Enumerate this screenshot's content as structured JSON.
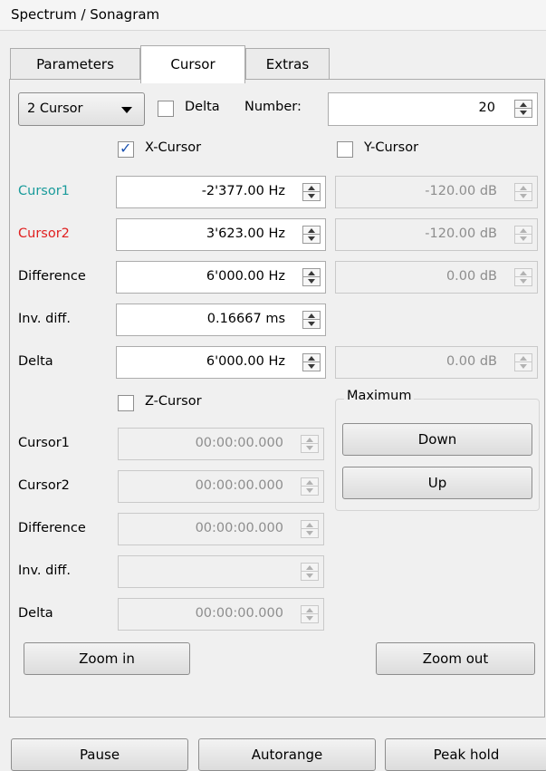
{
  "window_title": "Spectrum / Sonagram",
  "tabs": [
    {
      "label": "Parameters",
      "active": false
    },
    {
      "label": "Cursor",
      "active": true
    },
    {
      "label": "Extras",
      "active": false
    }
  ],
  "cursor_mode": {
    "selected": "2 Cursor"
  },
  "delta_checkbox": {
    "label": "Delta",
    "checked": false
  },
  "number": {
    "label": "Number:",
    "value": "20"
  },
  "x_cursor": {
    "label": "X-Cursor",
    "checked": true
  },
  "y_cursor": {
    "label": "Y-Cursor",
    "checked": false
  },
  "xy_rows": [
    {
      "label": "Cursor1",
      "label_color": "#1a9b9b",
      "x_value": "-2'377.00 Hz",
      "y_value": "-120.00 dB"
    },
    {
      "label": "Cursor2",
      "label_color": "#e02020",
      "x_value": "3'623.00 Hz",
      "y_value": "-120.00 dB"
    },
    {
      "label": "Difference",
      "label_color": "#000000",
      "x_value": "6'000.00 Hz",
      "y_value": "0.00 dB"
    },
    {
      "label": "Inv. diff.",
      "label_color": "#000000",
      "x_value": "0.16667 ms",
      "y_value": null
    },
    {
      "label": "Delta",
      "label_color": "#000000",
      "x_value": "6'000.00 Hz",
      "y_value": "0.00 dB"
    }
  ],
  "z_cursor": {
    "label": "Z-Cursor",
    "checked": false
  },
  "z_rows": [
    {
      "label": "Cursor1",
      "value": "00:00:00.000"
    },
    {
      "label": "Cursor2",
      "value": "00:00:00.000"
    },
    {
      "label": "Difference",
      "value": "00:00:00.000"
    },
    {
      "label": "Inv. diff.",
      "value": ""
    },
    {
      "label": "Delta",
      "value": "00:00:00.000"
    }
  ],
  "maximum_group": {
    "title": "Maximum",
    "down_label": "Down",
    "up_label": "Up"
  },
  "zoom": {
    "in_label": "Zoom in",
    "out_label": "Zoom out"
  },
  "bottom_buttons": {
    "pause": "Pause",
    "autorange": "Autorange",
    "peak_hold": "Peak hold"
  },
  "icons": {
    "checkbox_check": "checkmark-icon",
    "spin": "spin-arrows-icon",
    "dropdown": "caret-down-icon"
  }
}
